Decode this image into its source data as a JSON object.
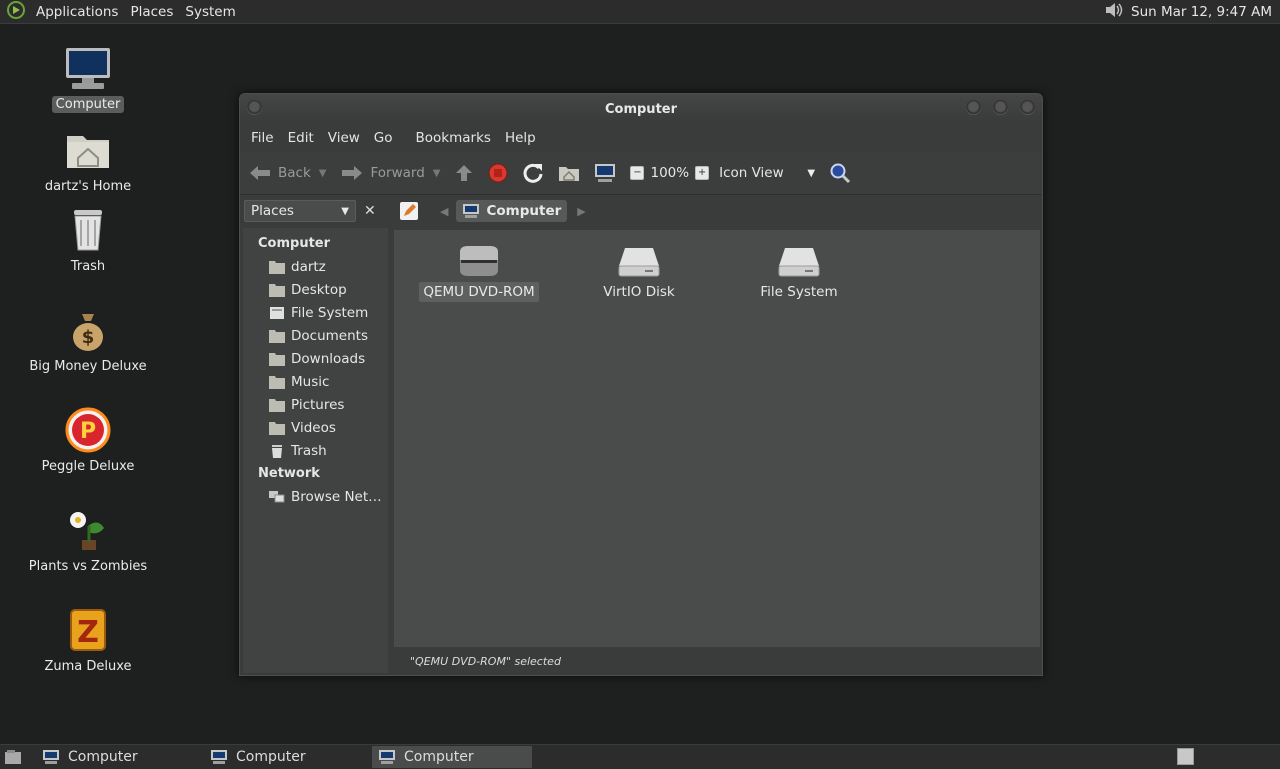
{
  "top_panel": {
    "menus": [
      "Applications",
      "Places",
      "System"
    ],
    "clock": "Sun Mar 12,  9:47 AM"
  },
  "desktop": {
    "icons": [
      {
        "label": "Computer",
        "icon": "computer-icon"
      },
      {
        "label": "dartz's Home",
        "icon": "home-folder-icon"
      },
      {
        "label": "Trash",
        "icon": "trash-icon"
      },
      {
        "label": "Big Money Deluxe",
        "icon": "money-bag-icon"
      },
      {
        "label": "Peggle Deluxe",
        "icon": "peggle-icon"
      },
      {
        "label": "Plants vs Zombies",
        "icon": "plants-icon"
      },
      {
        "label": "Zuma Deluxe",
        "icon": "zuma-icon"
      }
    ]
  },
  "window": {
    "title": "Computer",
    "menu": [
      "File",
      "Edit",
      "View",
      "Go",
      "Bookmarks",
      "Help"
    ],
    "toolbar": {
      "back": "Back",
      "forward": "Forward",
      "zoom": "100%",
      "view_mode": "Icon View"
    },
    "side_pane": {
      "selector": "Places",
      "sections": [
        {
          "heading": "Computer",
          "items": [
            "dartz",
            "Desktop",
            "File System",
            "Documents",
            "Downloads",
            "Music",
            "Pictures",
            "Videos",
            "Trash"
          ]
        },
        {
          "heading": "Network",
          "items": [
            "Browse Net…"
          ]
        }
      ]
    },
    "location": {
      "crumb": "Computer"
    },
    "files": [
      {
        "label": "QEMU DVD-ROM",
        "icon": "optical-drive-icon",
        "selected": true
      },
      {
        "label": "VirtIO Disk",
        "icon": "hard-disk-icon",
        "selected": false
      },
      {
        "label": "File System",
        "icon": "hard-disk-icon",
        "selected": false
      }
    ],
    "status": "\"QEMU DVD-ROM\" selected"
  },
  "bottom_panel": {
    "tasks": [
      "Computer",
      "Computer",
      "Computer"
    ],
    "active_task": 2
  },
  "colors": {
    "desktop_bg": "#1e201f",
    "panel_bg": "#2b2c2b",
    "content_bg": "#4a4b4b",
    "stop_red": "#d43a2f"
  }
}
